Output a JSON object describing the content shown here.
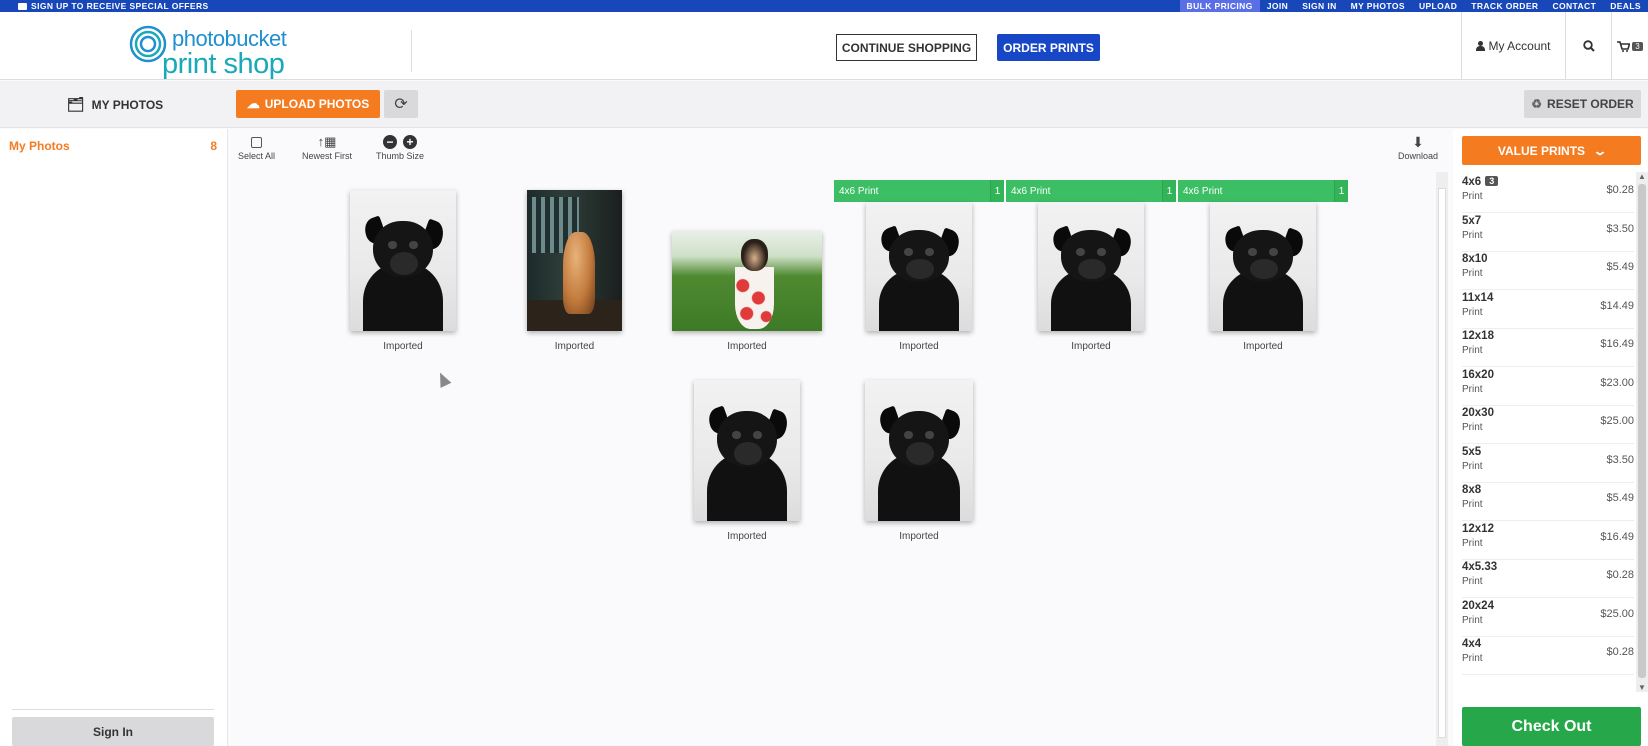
{
  "topbar": {
    "promo": "SIGN UP TO RECEIVE SPECIAL OFFERS",
    "links": [
      "BULK PRICING",
      "JOIN",
      "SIGN IN",
      "MY PHOTOS",
      "UPLOAD",
      "TRACK ORDER",
      "CONTACT",
      "DEALS"
    ]
  },
  "header": {
    "logo_brand": "photobucket",
    "logo_shop": "print shop",
    "continue_label": "CONTINUE SHOPPING",
    "order_label": "ORDER PRINTS",
    "account_label": "My Account",
    "cart_count": "3"
  },
  "toolbar": {
    "myphotos_label": "MY PHOTOS",
    "upload_label": "UPLOAD PHOTOS",
    "reset_label": "RESET ORDER"
  },
  "sidebar": {
    "item_label": "My Photos",
    "item_count": "8",
    "signin_label": "Sign In"
  },
  "gallery_tools": {
    "select_all": "Select All",
    "sort": "Newest First",
    "thumb_size": "Thumb Size",
    "download": "Download"
  },
  "photos": [
    {
      "caption": "Imported",
      "image": "pug"
    },
    {
      "caption": "Imported",
      "image": "dog-by-window"
    },
    {
      "caption": "Imported",
      "image": "puppy-in-cup"
    },
    {
      "caption": "Imported",
      "image": "pug",
      "tag": "4x6 Print",
      "tag_count": "1"
    },
    {
      "caption": "Imported",
      "image": "pug",
      "tag": "4x6 Print",
      "tag_count": "1"
    },
    {
      "caption": "Imported",
      "image": "pug",
      "tag": "4x6 Print",
      "tag_count": "1"
    },
    {
      "caption": "Imported",
      "image": "pug"
    },
    {
      "caption": "Imported",
      "image": "pug"
    }
  ],
  "panel": {
    "category_label": "VALUE PRINTS",
    "print_label": "Print",
    "products": [
      {
        "size": "4x6",
        "count": "3",
        "price": "$0.28"
      },
      {
        "size": "5x7",
        "price": "$3.50"
      },
      {
        "size": "8x10",
        "price": "$5.49"
      },
      {
        "size": "11x14",
        "price": "$14.49"
      },
      {
        "size": "12x18",
        "price": "$16.49"
      },
      {
        "size": "16x20",
        "price": "$23.00"
      },
      {
        "size": "20x30",
        "price": "$25.00"
      },
      {
        "size": "5x5",
        "price": "$3.50"
      },
      {
        "size": "8x8",
        "price": "$5.49"
      },
      {
        "size": "12x12",
        "price": "$16.49"
      },
      {
        "size": "4x5.33",
        "price": "$0.28"
      },
      {
        "size": "20x24",
        "price": "$25.00"
      },
      {
        "size": "4x4",
        "price": "$0.28"
      }
    ],
    "checkout_label": "Check Out"
  },
  "colors": {
    "brand_blue": "#1747b8",
    "orange": "#f47b20",
    "green": "#3cbf64"
  }
}
